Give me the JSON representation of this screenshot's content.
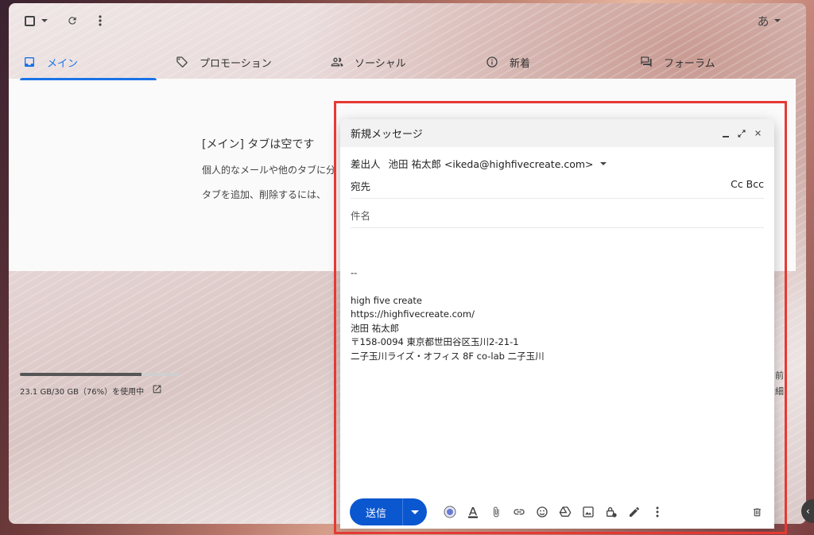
{
  "toolbar": {
    "input_mode_label": "あ"
  },
  "tabs": [
    {
      "label": "メイン",
      "icon": "inbox-icon"
    },
    {
      "label": "プロモーション",
      "icon": "tag-icon"
    },
    {
      "label": "ソーシャル",
      "icon": "people-icon"
    },
    {
      "label": "新着",
      "icon": "info-icon"
    },
    {
      "label": "フォーラム",
      "icon": "forum-icon"
    }
  ],
  "inbox": {
    "empty_title": "[メイン] タブは空です",
    "line1": "個人的なメールや他のタブに分",
    "line2": "タブを追加、削除するには、"
  },
  "storage": {
    "text": "23.1 GB/30 GB（76%）を使用中",
    "used_fraction": 0.76
  },
  "side_fragments": [
    "前",
    "細"
  ],
  "compose": {
    "title": "新規メッセージ",
    "from_label": "差出人",
    "from_value": "池田 祐太郎 <ikeda@highfivecreate.com>",
    "to_label": "宛先",
    "cc_bcc": "Cc Bcc",
    "subject_placeholder": "件名",
    "signature_dash": "--",
    "signature_lines": [
      "high five create",
      "https://highfivecreate.com/",
      "池田 祐太郎",
      "〒158-0094 東京都世田谷区玉川2-21-1",
      "二子玉川ライズ・オフィス 8F co-lab 二子玉川"
    ],
    "send_label": "送信",
    "formatting_icons": [
      "ai-icon",
      "text-format-icon",
      "attach-icon",
      "link-icon",
      "emoji-icon",
      "drive-icon",
      "photo-icon",
      "confidential-icon",
      "signature-icon",
      "more-options-icon"
    ]
  },
  "colors": {
    "accent": "#1a73e8",
    "send_button": "#0b57d0",
    "highlight_box": "#e53935"
  }
}
